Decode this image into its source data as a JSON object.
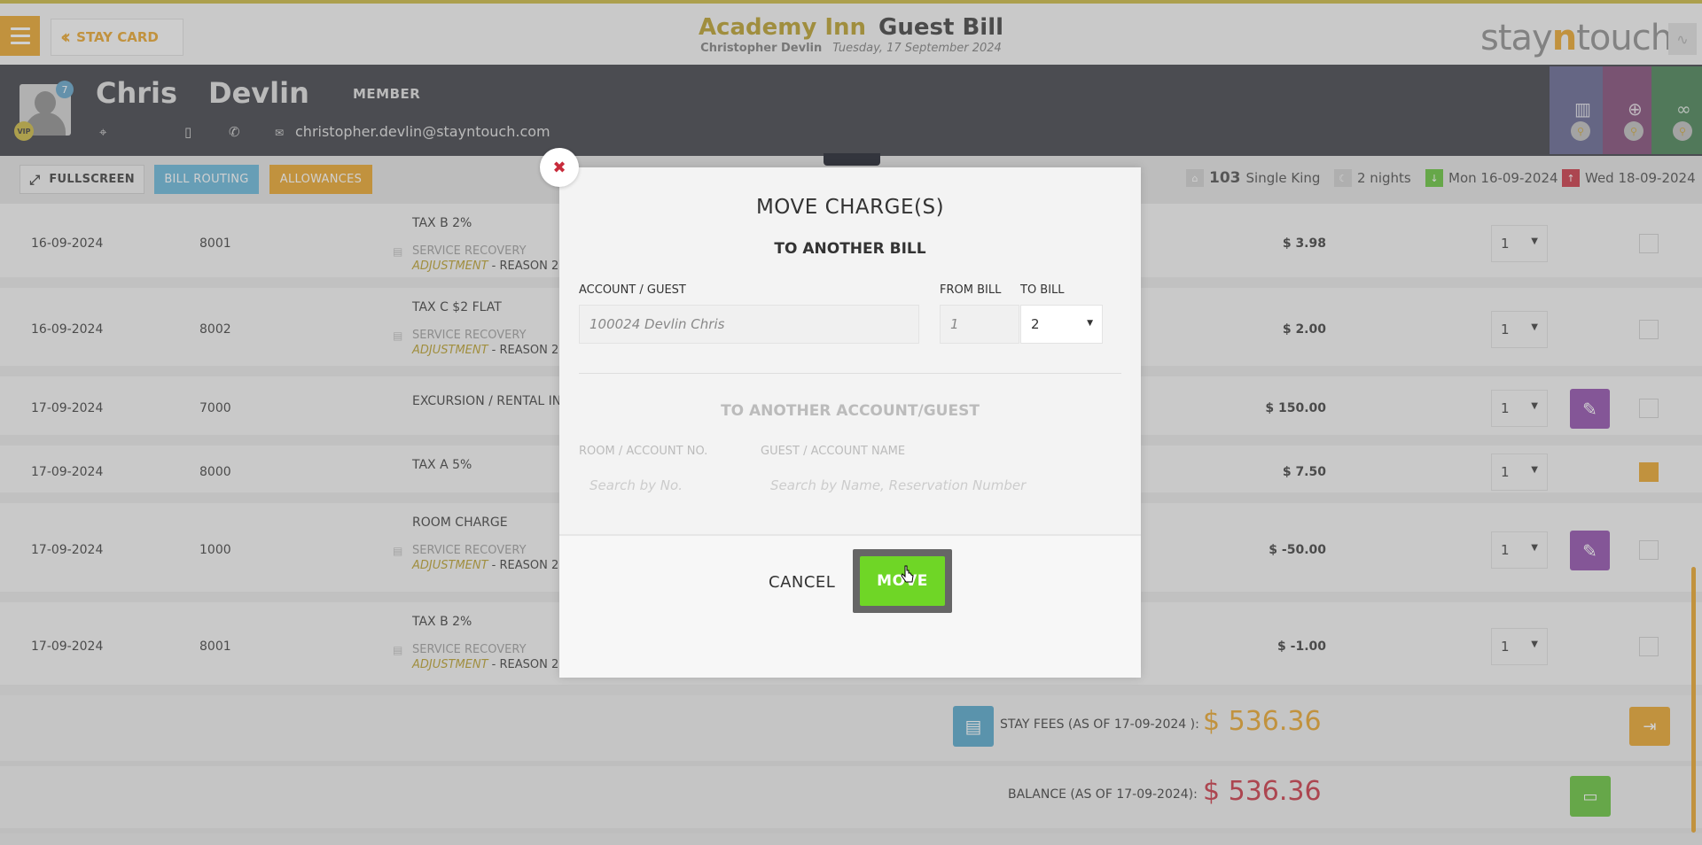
{
  "topbar": {
    "stay_card_label": "STAY CARD",
    "hotel_name": "Academy Inn",
    "bill_title": "Guest Bill",
    "guest_name": "Christopher Devlin",
    "date": "Tuesday, 17 September 2024",
    "logo_left": "stay",
    "logo_mid": "n",
    "logo_right": "touch"
  },
  "guest": {
    "first_name": "Chris",
    "last_name": "Devlin",
    "status": "MEMBER",
    "badge_count": "7",
    "vip_label": "VIP",
    "email": "christopher.devlin@stayntouch.com",
    "tab_colors": [
      "#5b5d8a",
      "#7a3f6f",
      "#3d7a4a"
    ]
  },
  "toolbar": {
    "fullscreen_label": "FULLSCREEN",
    "bill_routing_label": "BILL ROUTING",
    "allowances_label": "ALLOWANCES",
    "room_number": "103",
    "room_type": "Single King",
    "nights": "2 nights",
    "arrival": "Mon 16-09-2024",
    "departure": "Wed 18-09-2024"
  },
  "charges": [
    {
      "date": "16-09-2024",
      "code": "8001",
      "description": "TAX B 2%",
      "sub": "SERVICE RECOVERY",
      "adj_label": "ADJUSTMENT",
      "adj_reason": " - REASON 2",
      "amount": "$ 3.98",
      "qty": "1",
      "editable": false,
      "checked": false
    },
    {
      "date": "16-09-2024",
      "code": "8002",
      "description": "TAX C $2 FLAT",
      "sub": "SERVICE RECOVERY",
      "adj_label": "ADJUSTMENT",
      "adj_reason": " - REASON 2",
      "amount": "$ 2.00",
      "qty": "1",
      "editable": false,
      "checked": false
    },
    {
      "date": "17-09-2024",
      "code": "7000",
      "description": "EXCURSION / RENTAL INC",
      "sub": "",
      "adj_label": "",
      "adj_reason": "",
      "amount": "$ 150.00",
      "qty": "1",
      "editable": true,
      "checked": false
    },
    {
      "date": "17-09-2024",
      "code": "8000",
      "description": "TAX A 5%",
      "sub": "",
      "adj_label": "",
      "adj_reason": "",
      "amount": "$ 7.50",
      "qty": "1",
      "editable": false,
      "checked": true
    },
    {
      "date": "17-09-2024",
      "code": "1000",
      "description": "ROOM CHARGE",
      "sub": "SERVICE RECOVERY",
      "adj_label": "ADJUSTMENT",
      "adj_reason": " - REASON 2",
      "amount": "$ -50.00",
      "qty": "1",
      "editable": true,
      "checked": false
    },
    {
      "date": "17-09-2024",
      "code": "8001",
      "description": "TAX B 2%",
      "sub": "SERVICE RECOVERY",
      "adj_label": "ADJUSTMENT",
      "adj_reason": " - REASON 2",
      "amount": "$ -1.00",
      "qty": "1",
      "editable": false,
      "checked": false
    }
  ],
  "totals": {
    "stay_fees_label": "STAY FEES (AS OF  17-09-2024 ):",
    "stay_fees_amount": "$ 536.36",
    "balance_label": "BALANCE (AS OF  17-09-2024):",
    "balance_amount": "$ 536.36"
  },
  "modal": {
    "title": "MOVE CHARGE(S)",
    "subtitle_bill": "TO ANOTHER BILL",
    "account_label": "ACCOUNT / GUEST",
    "account_value": "100024 Devlin Chris",
    "from_bill_label": "FROM BILL",
    "from_bill_value": "1",
    "to_bill_label": "TO BILL",
    "to_bill_value": "2",
    "subtitle_account": "TO ANOTHER ACCOUNT/GUEST",
    "room_label": "ROOM / ACCOUNT NO.",
    "room_placeholder": "Search by No.",
    "guest_label": "GUEST / ACCOUNT NAME",
    "guest_placeholder": "Search by Name, Reservation Number",
    "cancel_label": "CANCEL",
    "move_label": "MOVE"
  }
}
